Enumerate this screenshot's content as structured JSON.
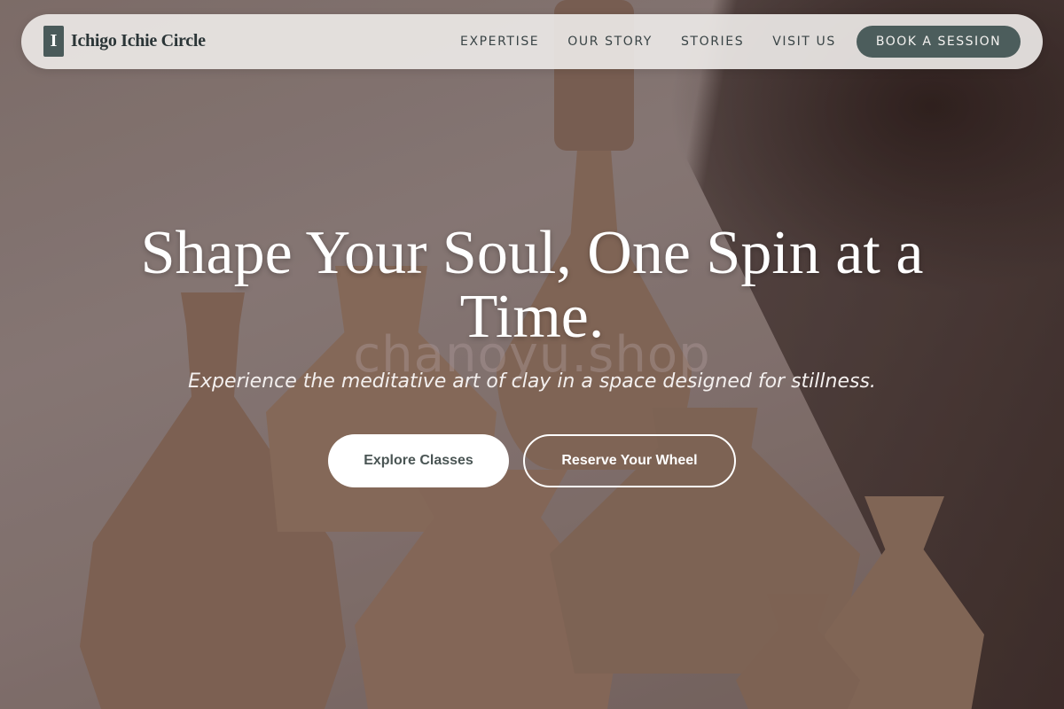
{
  "brand": {
    "logo_letter": "I",
    "name": "Ichigo Ichie Circle"
  },
  "nav": {
    "links": [
      "EXPERTISE",
      "OUR STORY",
      "STORIES",
      "VISIT US"
    ],
    "cta_label": "BOOK A SESSION"
  },
  "hero": {
    "headline": "Shape Your Soul, One Spin at a Time.",
    "subheadline": "Experience the meditative art of clay in a space designed for stillness.",
    "primary_button": "Explore Classes",
    "secondary_button": "Reserve Your Wheel",
    "watermark": "chanoyu.shop",
    "background_image": "clay-vases-photo"
  },
  "colors": {
    "accent": "#4c5d5c",
    "nav_background": "#ece8e6",
    "text_dark": "#2b3537",
    "clay": "#8e715f"
  }
}
